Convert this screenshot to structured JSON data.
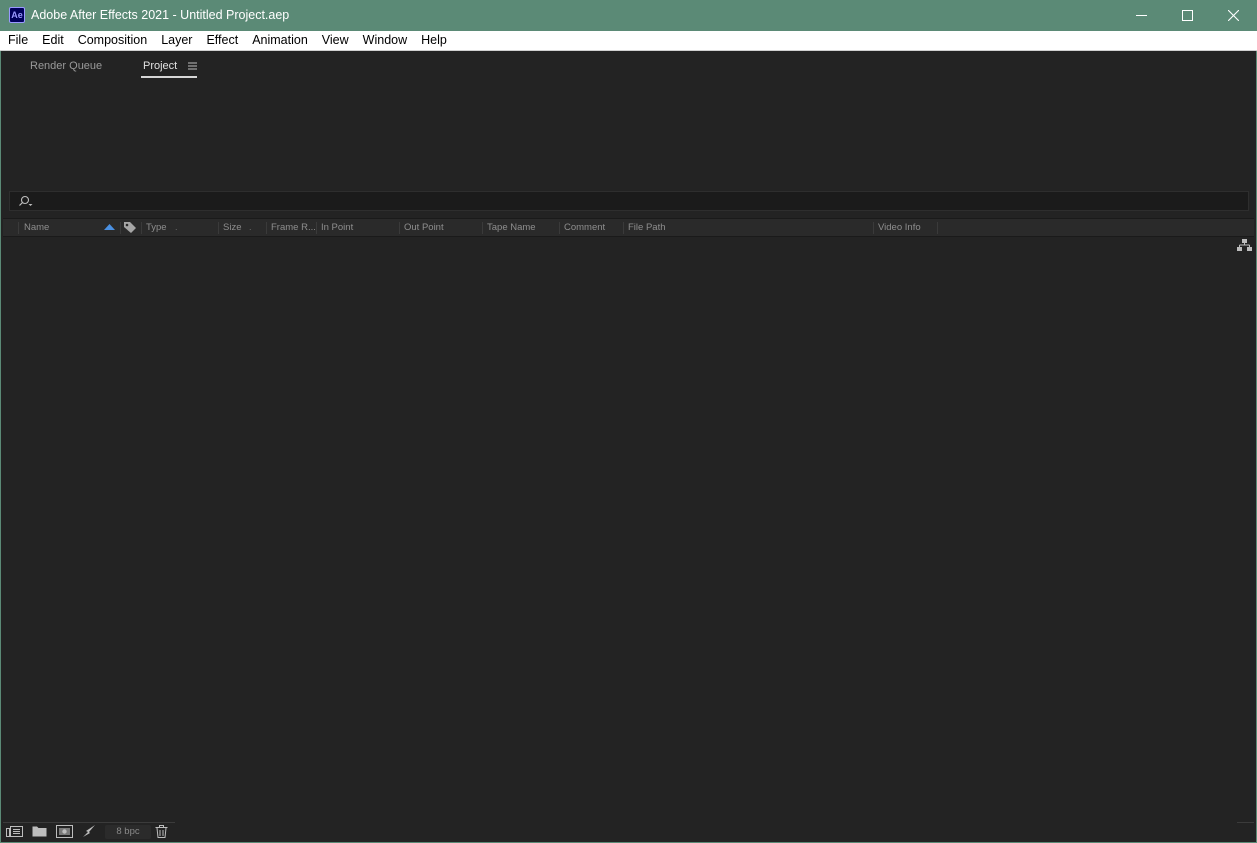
{
  "window": {
    "title": "Adobe After Effects 2021 - Untitled Project.aep",
    "app_icon_text": "Ae",
    "controls": [
      "minimize-icon",
      "maximize-icon",
      "close-icon"
    ]
  },
  "menu": {
    "items": [
      "File",
      "Edit",
      "Composition",
      "Layer",
      "Effect",
      "Animation",
      "View",
      "Window",
      "Help"
    ]
  },
  "tabs": [
    {
      "label": "Render Queue",
      "active": false
    },
    {
      "label": "Project",
      "active": true
    }
  ],
  "search": {
    "value": "",
    "placeholder": ""
  },
  "columns": [
    "Name",
    "Type",
    "Size",
    "Frame R...",
    "In Point",
    "Out Point",
    "Tape Name",
    "Comment",
    "File Path",
    "Video Info"
  ],
  "footer": {
    "bpc_label": "8 bpc",
    "icons": [
      "interpret-footage-icon",
      "new-folder-icon",
      "new-composition-icon",
      "adjust-settings-icon",
      "delete-icon"
    ]
  },
  "colors": {
    "titlebar": "#5b8a76",
    "panel_bg": "#232323",
    "accent": "#4a90e2"
  }
}
